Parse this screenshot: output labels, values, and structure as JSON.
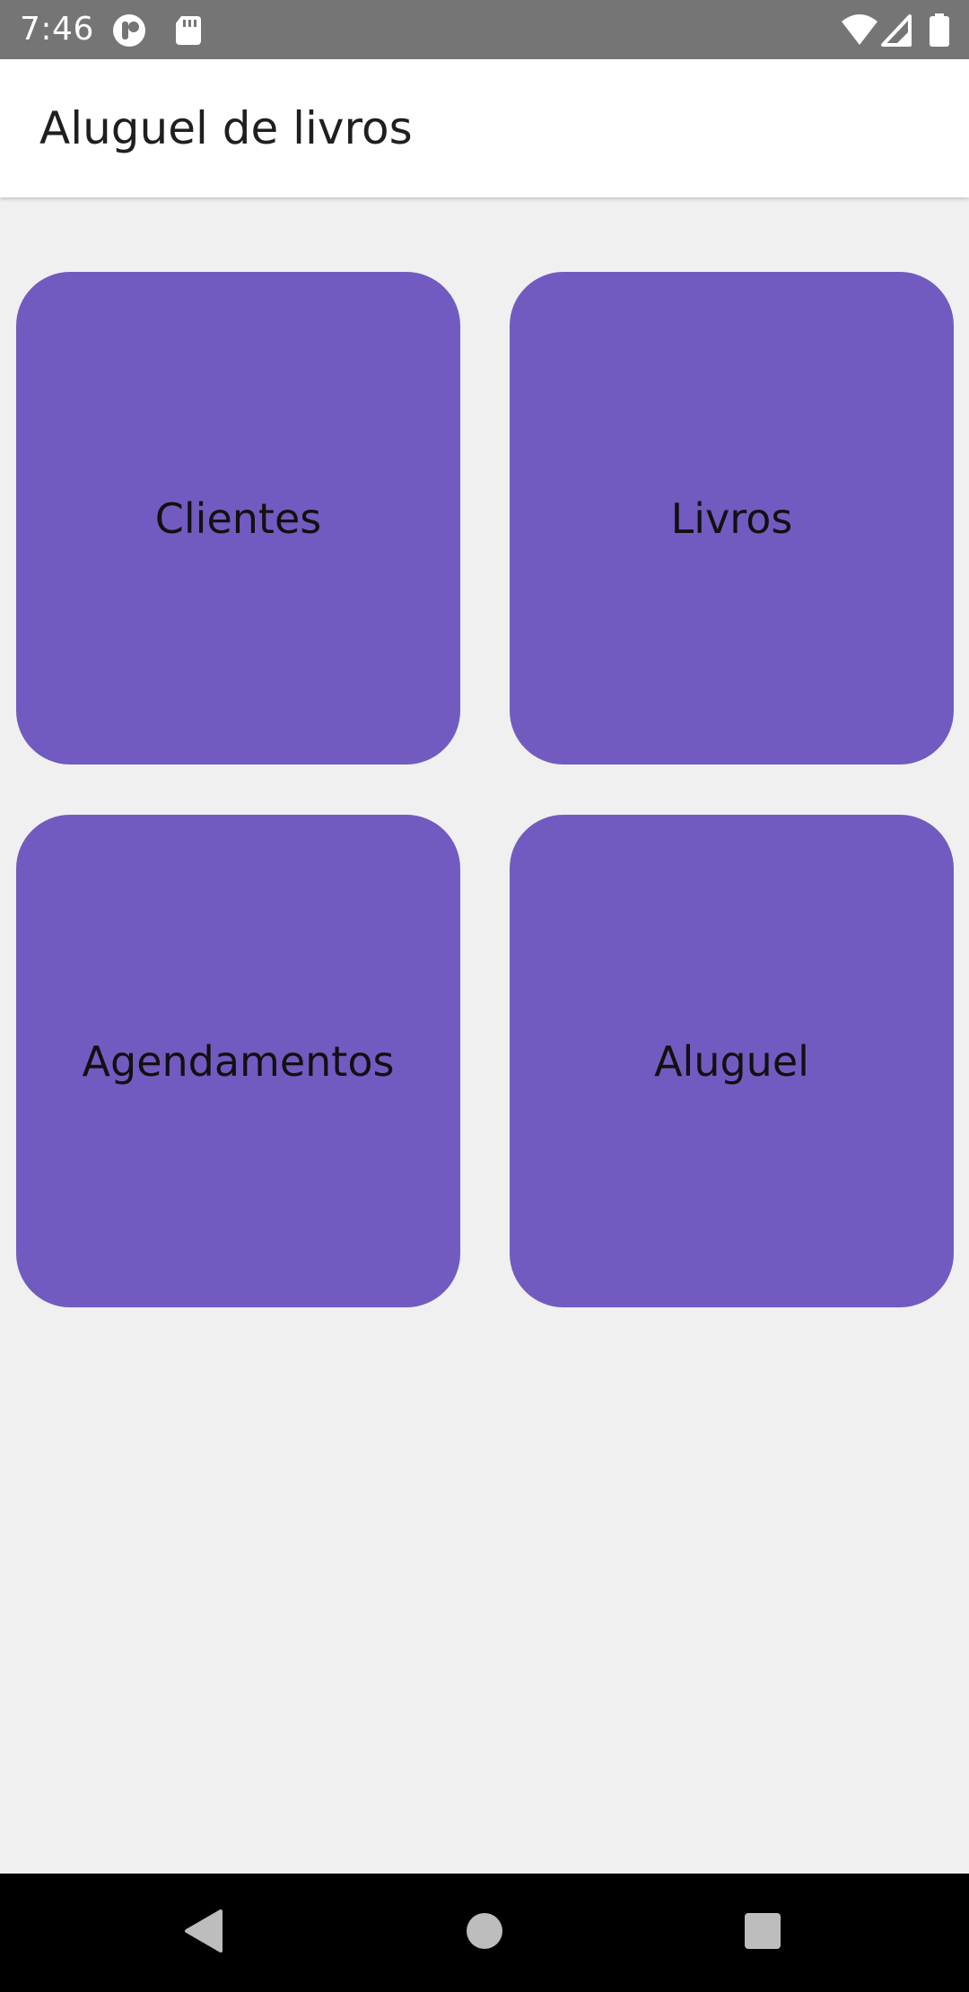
{
  "status_bar": {
    "time": "7:46",
    "left_icons": [
      "notification-app-icon",
      "sd-card-icon"
    ],
    "right_icons": [
      "wifi-icon",
      "cellular-signal-icon",
      "battery-icon"
    ]
  },
  "app_bar": {
    "title": "Aluguel de livros"
  },
  "tiles": [
    {
      "label": "Clientes"
    },
    {
      "label": "Livros"
    },
    {
      "label": "Agendamentos"
    },
    {
      "label": "Aluguel"
    }
  ],
  "nav_bar": {
    "buttons": [
      "back-icon",
      "home-icon",
      "recents-icon"
    ]
  },
  "colors": {
    "status_bar": "#757575",
    "app_bar": "#ffffff",
    "background": "#f0f0f0",
    "tile": "#725bc0",
    "nav_bar": "#000000"
  }
}
